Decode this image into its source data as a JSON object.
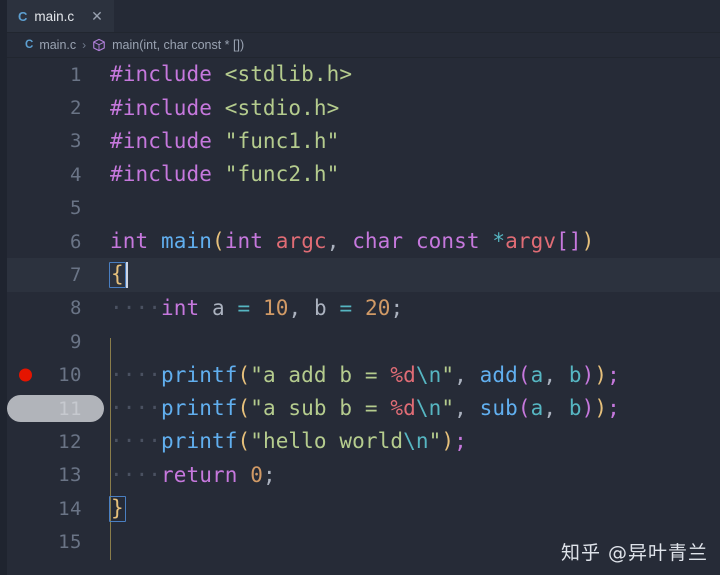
{
  "window": {
    "background_color": "#262b37",
    "activity_bar_color": "#1f242f"
  },
  "tabbar": {
    "tabs": [
      {
        "icon_letter": "C",
        "icon_name": "c-file-icon",
        "label": "main.c",
        "close_glyph": "✕",
        "active": true
      }
    ]
  },
  "breadcrumbs": {
    "file_icon_letter": "C",
    "file_label": "main.c",
    "separator": "›",
    "symbol_icon_name": "method-cube-icon",
    "symbol_label": "main(int, char const * [])"
  },
  "editor": {
    "language": "c",
    "cursor_line": 7,
    "breakpoint_lines": [
      10
    ],
    "gutter_hover_line": 11,
    "first_visible_line": 1,
    "last_visible_line": 15,
    "lines": [
      {
        "n": "1",
        "text": "#include <stdlib.h>"
      },
      {
        "n": "2",
        "text": "#include <stdio.h>"
      },
      {
        "n": "3",
        "text": "#include \"func1.h\""
      },
      {
        "n": "4",
        "text": "#include \"func2.h\""
      },
      {
        "n": "5",
        "text": ""
      },
      {
        "n": "6",
        "text": "int main(int argc, char const *argv[])"
      },
      {
        "n": "7",
        "text": "{"
      },
      {
        "n": "8",
        "text": "    int a = 10, b = 20;"
      },
      {
        "n": "9",
        "text": ""
      },
      {
        "n": "10",
        "text": "    printf(\"a add b = %d\\n\", add(a, b));"
      },
      {
        "n": "11",
        "text": "    printf(\"a sub b = %d\\n\", sub(a, b));"
      },
      {
        "n": "12",
        "text": "    printf(\"hello world\\n\");"
      },
      {
        "n": "13",
        "text": "    return 0;"
      },
      {
        "n": "14",
        "text": "}"
      },
      {
        "n": "15",
        "text": ""
      }
    ],
    "tokens": {
      "line1": [
        [
          "#include",
          "t-pre"
        ],
        [
          " ",
          ""
        ],
        [
          "<stdlib.h>",
          "t-str"
        ]
      ],
      "line2": [
        [
          "#include",
          "t-pre"
        ],
        [
          " ",
          ""
        ],
        [
          "<stdio.h>",
          "t-str"
        ]
      ],
      "line3": [
        [
          "#include",
          "t-pre"
        ],
        [
          " ",
          ""
        ],
        [
          "\"func1.h\"",
          "t-str"
        ]
      ],
      "line4": [
        [
          "#include",
          "t-pre"
        ],
        [
          " ",
          ""
        ],
        [
          "\"func2.h\"",
          "t-str"
        ]
      ],
      "line6": [
        [
          "int",
          "t-type"
        ],
        [
          " ",
          ""
        ],
        [
          "main",
          "t-fn"
        ],
        [
          "(",
          "t-br1"
        ],
        [
          "int",
          "t-type"
        ],
        [
          " ",
          ""
        ],
        [
          "argc",
          "t-param"
        ],
        [
          ", ",
          "t-punct"
        ],
        [
          "char",
          "t-type"
        ],
        [
          " ",
          ""
        ],
        [
          "const",
          "t-type"
        ],
        [
          " ",
          ""
        ],
        [
          "*",
          "t-op"
        ],
        [
          "argv",
          "t-param"
        ],
        [
          "[]",
          "t-br2"
        ],
        [
          ")",
          "t-br1"
        ]
      ],
      "line7": [
        [
          "{",
          "t-br1"
        ]
      ],
      "line8": [
        [
          "int",
          "t-type"
        ],
        [
          " ",
          ""
        ],
        [
          "a",
          "t-var2"
        ],
        [
          " ",
          ""
        ],
        [
          "=",
          "t-op"
        ],
        [
          " ",
          ""
        ],
        [
          "10",
          "t-num"
        ],
        [
          ", ",
          "t-punct"
        ],
        [
          "b",
          "t-var2"
        ],
        [
          " ",
          ""
        ],
        [
          "=",
          "t-op"
        ],
        [
          " ",
          ""
        ],
        [
          "20",
          "t-num"
        ],
        [
          ";",
          "t-punct"
        ]
      ],
      "line10": [
        [
          "printf",
          "t-fn"
        ],
        [
          "(",
          "t-br1"
        ],
        [
          "\"a add b = ",
          "t-str"
        ],
        [
          "%d",
          "t-fmt"
        ],
        [
          "\\n",
          "t-esc"
        ],
        [
          "\"",
          "t-str"
        ],
        [
          ", ",
          "t-punct"
        ],
        [
          "add",
          "t-fn"
        ],
        [
          "(",
          "t-br2"
        ],
        [
          "a",
          "t-var"
        ],
        [
          ", ",
          "t-punct"
        ],
        [
          "b",
          "t-var"
        ],
        [
          ")",
          "t-br2"
        ],
        [
          ")",
          "t-br1"
        ],
        [
          ";",
          "t-semi"
        ]
      ],
      "line11": [
        [
          "printf",
          "t-fn"
        ],
        [
          "(",
          "t-br1"
        ],
        [
          "\"a sub b = ",
          "t-str"
        ],
        [
          "%d",
          "t-fmt"
        ],
        [
          "\\n",
          "t-esc"
        ],
        [
          "\"",
          "t-str"
        ],
        [
          ", ",
          "t-punct"
        ],
        [
          "sub",
          "t-fn"
        ],
        [
          "(",
          "t-br2"
        ],
        [
          "a",
          "t-var"
        ],
        [
          ", ",
          "t-punct"
        ],
        [
          "b",
          "t-var"
        ],
        [
          ")",
          "t-br2"
        ],
        [
          ")",
          "t-br1"
        ],
        [
          ";",
          "t-semi"
        ]
      ],
      "line12": [
        [
          "printf",
          "t-fn"
        ],
        [
          "(",
          "t-br1"
        ],
        [
          "\"hello world",
          "t-str"
        ],
        [
          "\\n",
          "t-esc"
        ],
        [
          "\"",
          "t-str"
        ],
        [
          ")",
          "t-br1"
        ],
        [
          ";",
          "t-semi"
        ]
      ],
      "line13": [
        [
          "return",
          "t-type"
        ],
        [
          " ",
          ""
        ],
        [
          "0",
          "t-num"
        ],
        [
          ";",
          "t-punct"
        ]
      ],
      "line14": [
        [
          "}",
          "t-br1"
        ]
      ]
    }
  },
  "watermark": {
    "text": "知乎 @异叶青兰"
  }
}
